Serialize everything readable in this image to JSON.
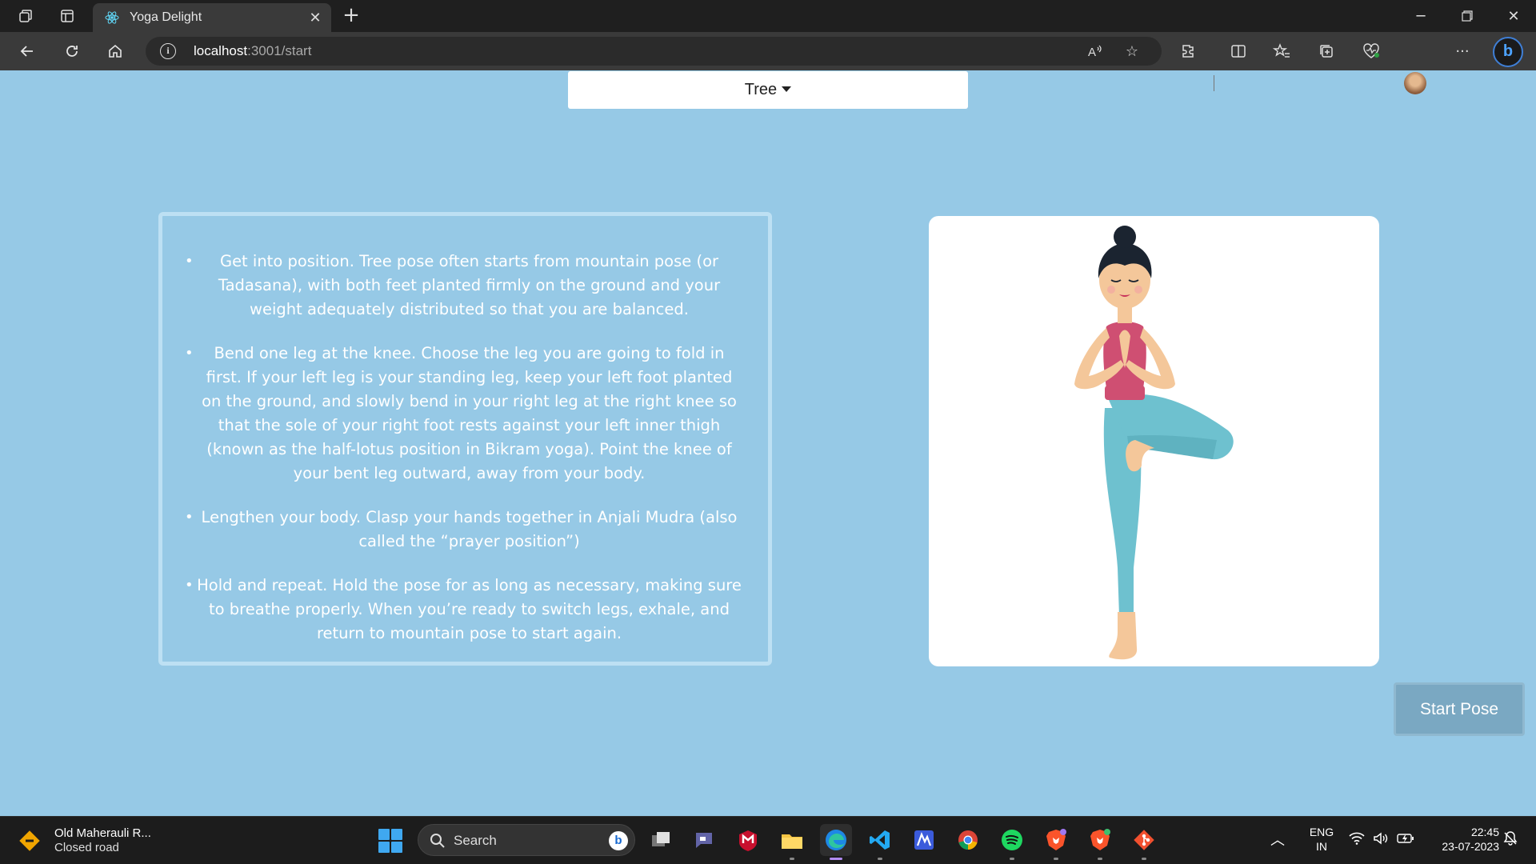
{
  "browser": {
    "tab_title": "Yoga Delight",
    "url_host": "localhost",
    "url_rest": ":3001/start"
  },
  "page": {
    "selected_pose": "Tree",
    "instructions": [
      "Get into position. Tree pose often starts from mountain pose (or Tadasana), with both feet planted firmly on the ground and your weight adequately distributed so that you are balanced.",
      "Bend one leg at the knee. Choose the leg you are going to fold in first. If your left leg is your standing leg, keep your left foot planted on the ground, and slowly bend in your right leg at the right knee so that the sole of your right foot rests against your left inner thigh (known as the half-lotus position in Bikram yoga). Point the knee of your bent leg outward, away from your body.",
      "Lengthen your body. Clasp your hands together in Anjali Mudra (also called the “prayer position”)",
      "Hold and repeat. Hold the pose for as long as necessary, making sure to breathe properly. When you’re ready to switch legs, exhale, and return to mountain pose to start again."
    ],
    "bullet": "•",
    "start_button_label": "Start Pose",
    "colors": {
      "background": "#96c9e6",
      "button": "#7aa8c2",
      "top_color": "#cf4f72",
      "leggings_color": "#6ec1cf",
      "skin_color": "#f4c79a"
    }
  },
  "taskbar": {
    "weather_title": "Old Maherauli R...",
    "weather_subtitle": "Closed road",
    "search_placeholder": "Search",
    "language_line1": "ENG",
    "language_line2": "IN",
    "time": "22:45",
    "date": "23-07-2023",
    "apps": [
      "task-view",
      "teams-chat",
      "mcafee",
      "file-explorer",
      "edge",
      "vscode",
      "app-m",
      "chrome",
      "spotify",
      "brave",
      "brave-beta",
      "git"
    ]
  }
}
